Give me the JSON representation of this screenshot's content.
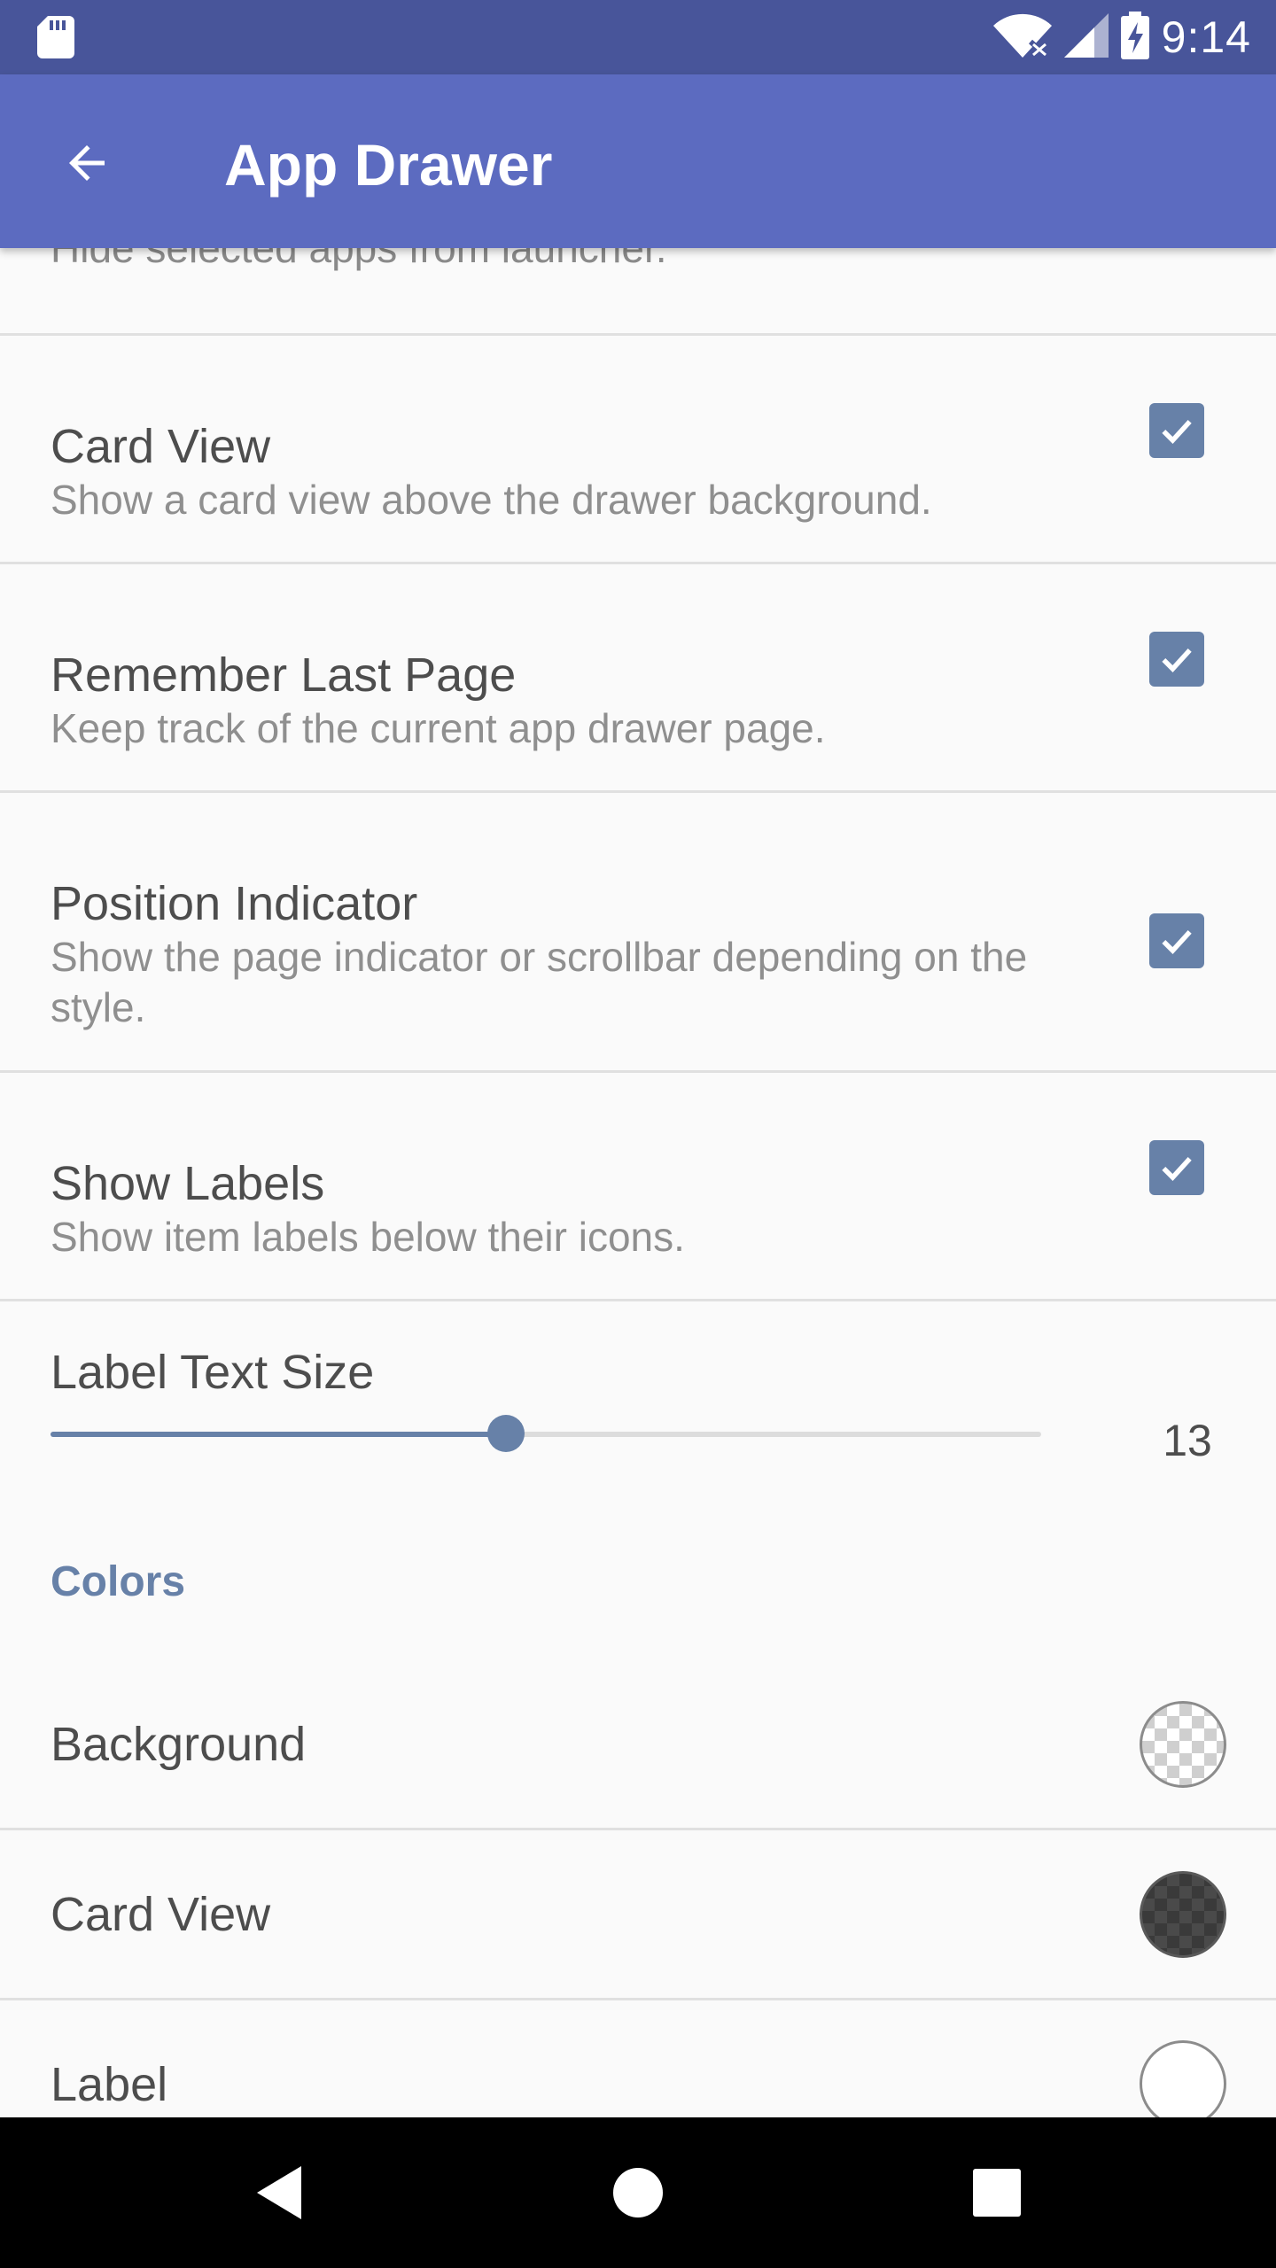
{
  "status_bar": {
    "time": "9:14",
    "icons": [
      "sd-card-icon",
      "wifi-icon",
      "signal-icon",
      "battery-charging-icon"
    ]
  },
  "app_bar": {
    "title": "App Drawer",
    "back_icon": "arrow-back-icon"
  },
  "partial_item": {
    "summary": "Hide selected apps from launcher."
  },
  "preferences": [
    {
      "title": "Card View",
      "summary": "Show a card view above the drawer background.",
      "checked": true
    },
    {
      "title": "Remember Last Page",
      "summary": "Keep track of the current app drawer page.",
      "checked": true
    },
    {
      "title": "Position Indicator",
      "summary": "Show the page indicator or scrollbar depending on the style.",
      "checked": true
    },
    {
      "title": "Show Labels",
      "summary": "Show item labels below their icons.",
      "checked": true
    }
  ],
  "label_text_size": {
    "title": "Label Text Size",
    "value": "13",
    "slider_fraction": 0.46
  },
  "colors_section": {
    "header": "Colors",
    "items": [
      {
        "title": "Background",
        "swatch": "transparent-checkered"
      },
      {
        "title": "Card View",
        "swatch": "dark-checkered"
      },
      {
        "title": "Label",
        "swatch": "white"
      }
    ]
  },
  "theme": {
    "status_bar": "#48559a",
    "app_bar": "#5c6bc0",
    "accent": "#6781a8",
    "background": "#fafafa"
  },
  "nav_bar": {
    "icons": [
      "back-triangle-icon",
      "home-circle-icon",
      "recents-square-icon"
    ]
  }
}
